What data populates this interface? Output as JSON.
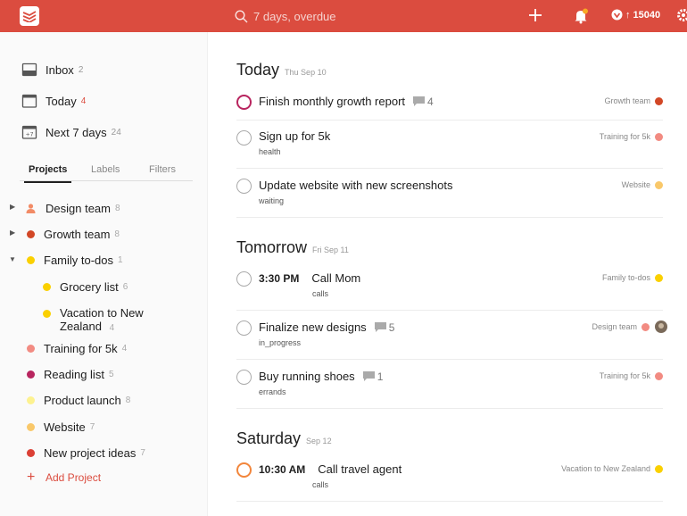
{
  "topbar": {
    "search_placeholder": "7 days, overdue",
    "karma": "15040",
    "colors": {
      "bar": "#db4c3f"
    }
  },
  "sidebar": {
    "filters": [
      {
        "label": "Inbox",
        "count": "2",
        "icon": "inbox-icon"
      },
      {
        "label": "Today",
        "count": "4",
        "icon": "calendar-today-icon"
      },
      {
        "label": "Next 7 days",
        "count": "24",
        "icon": "calendar-week-icon"
      }
    ],
    "tabs": [
      "Projects",
      "Labels",
      "Filters"
    ],
    "projects": [
      {
        "label": "Design team",
        "count": "8",
        "color": "#f9896b",
        "icon": "person-icon"
      },
      {
        "label": "Growth team",
        "count": "8",
        "color": "#d24726"
      },
      {
        "label": "Family to-dos",
        "count": "1",
        "color": "#fad000"
      },
      {
        "label": "Grocery list",
        "count": "6",
        "color": "#fad000"
      },
      {
        "label": "Vacation to New",
        "label2": "Zealand",
        "count": "4",
        "color": "#fad000"
      },
      {
        "label": "Training for 5k",
        "count": "4",
        "color": "#f28b82"
      },
      {
        "label": "Reading list",
        "count": "5",
        "color": "#b8255f"
      },
      {
        "label": "Product launch",
        "count": "8",
        "color": "#fdf290"
      },
      {
        "label": "Website",
        "count": "7",
        "color": "#f9c86a"
      },
      {
        "label": "New project ideas",
        "count": "7",
        "color": "#db4035"
      }
    ],
    "add_project": "Add Project"
  },
  "main": {
    "days": [
      {
        "name": "Today",
        "date": "Thu Sep 10"
      },
      {
        "name": "Tomorrow",
        "date": "Fri Sep 11"
      },
      {
        "name": "Saturday",
        "date": "Sep 12"
      }
    ],
    "tasks": [
      {
        "title": "Finish monthly growth report",
        "comments": "4",
        "label": "",
        "project": "Growth team",
        "color": "#d24726",
        "priority_color": "#b8255f"
      },
      {
        "title": "Sign up for 5k",
        "label": "health",
        "project": "Training for 5k",
        "color": "#f28b82"
      },
      {
        "title": "Update website with new screenshots",
        "label": "waiting",
        "project": "Website",
        "color": "#f9c86a"
      },
      {
        "time": "3:30 PM",
        "title": "Call Mom",
        "label": "calls",
        "project": "Family to-dos",
        "color": "#fad000"
      },
      {
        "title": "Finalize new designs",
        "comments": "5",
        "label": "in_progress",
        "project": "Design team",
        "color": "#f28b82"
      },
      {
        "title": "Buy running shoes",
        "comments": "1",
        "label": "errands",
        "project": "Training for 5k",
        "color": "#f28b82"
      },
      {
        "time": "10:30 AM",
        "title": "Call travel agent",
        "label": "calls",
        "project": "Vacation to New Zealand",
        "color": "#fad000",
        "priority_color": "#f2863c"
      }
    ]
  }
}
